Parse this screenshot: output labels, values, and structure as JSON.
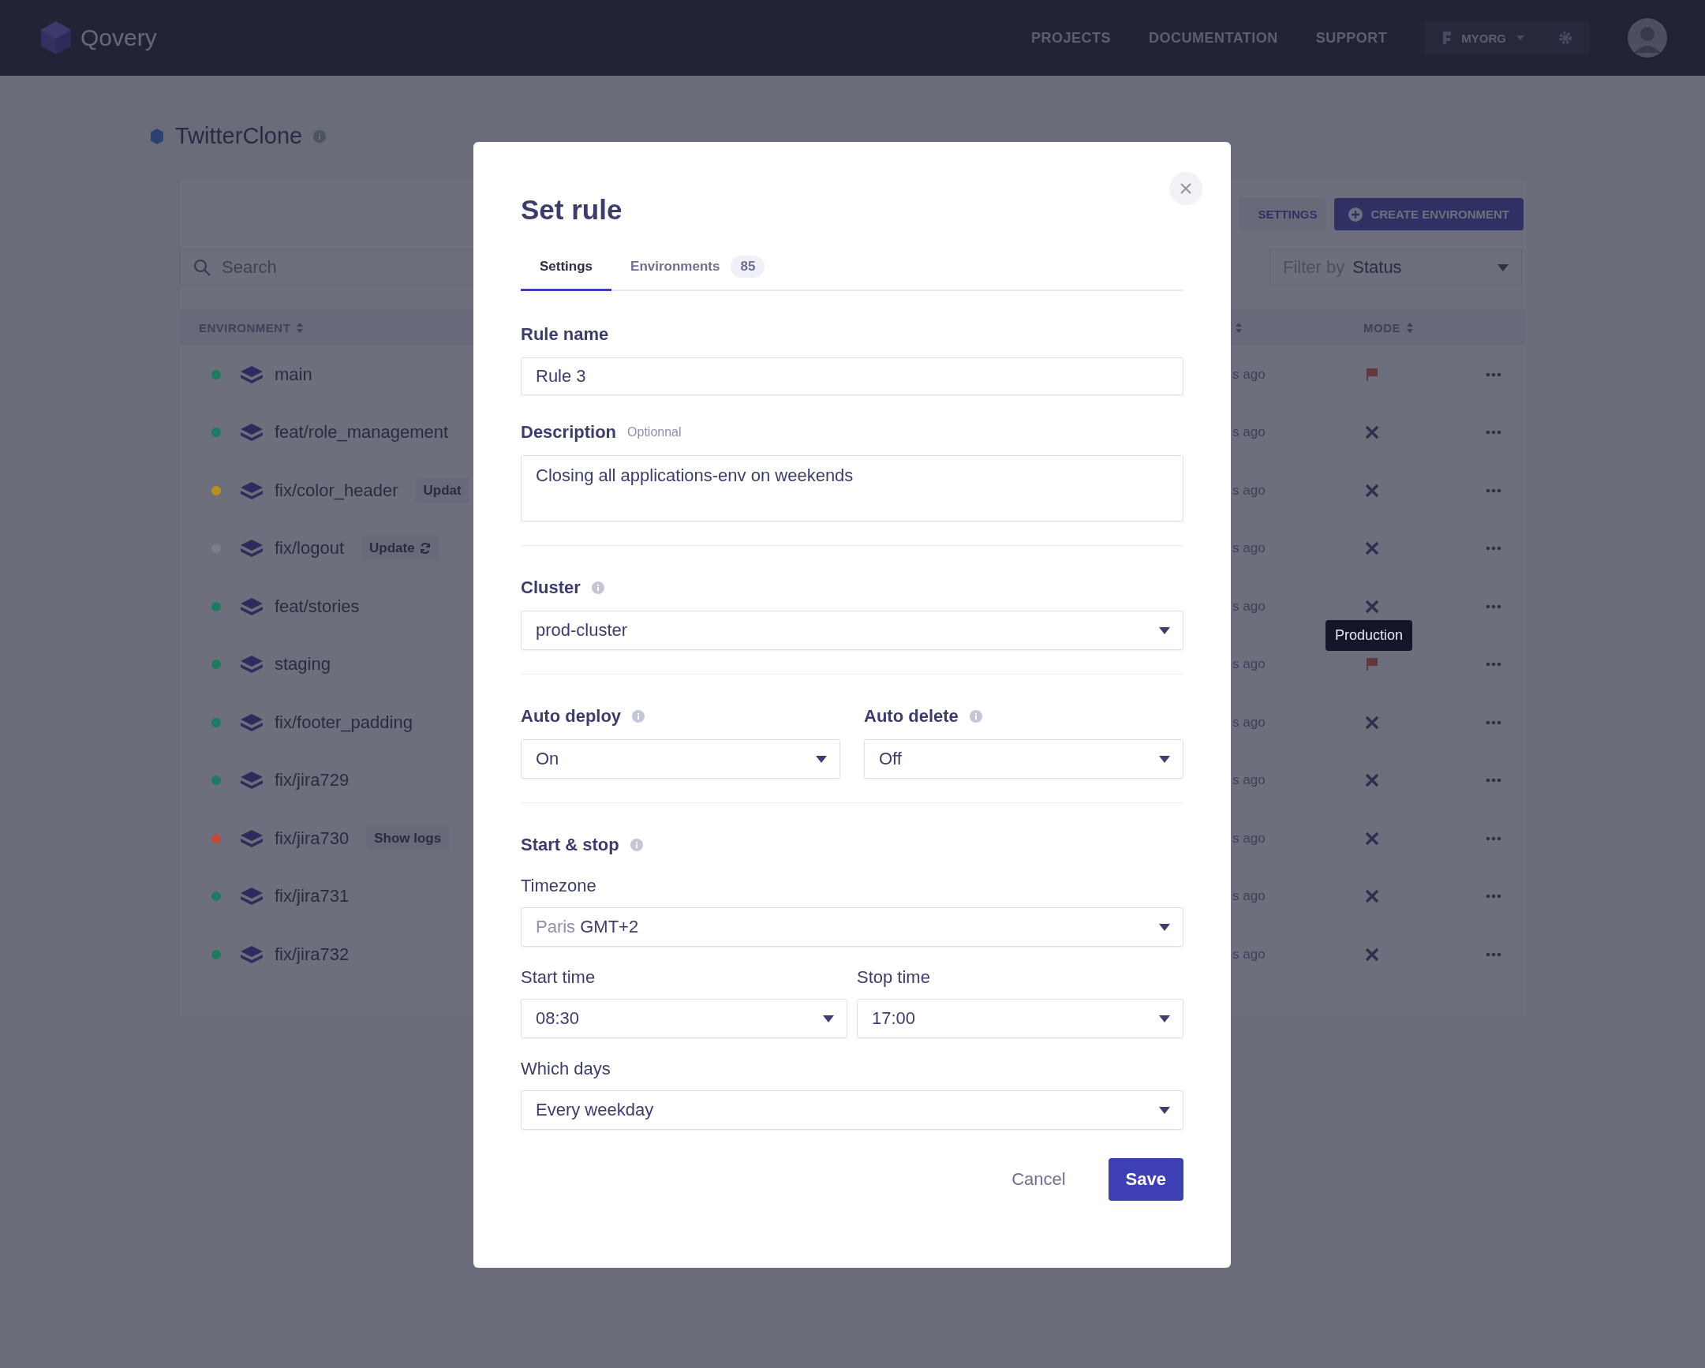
{
  "topbar": {
    "brand": "Qovery",
    "nav": [
      {
        "label": "PROJECTS"
      },
      {
        "label": "DOCUMENTATION"
      },
      {
        "label": "SUPPORT"
      }
    ],
    "org": "MYORG"
  },
  "project": {
    "title": "TwitterClone"
  },
  "toolbar": {
    "settings": "SETTINGS",
    "create": "CREATE ENVIRONMENT",
    "search_placeholder": "Search",
    "filter_label": "Filter by",
    "filter_value": "Status"
  },
  "table": {
    "columns": [
      "ENVIRONMENT",
      "MODE"
    ],
    "rows": [
      {
        "name": "main",
        "color": "#1e7a60",
        "updated": "s ago",
        "kind": "production"
      },
      {
        "name": "feat/role_management",
        "color": "#1e7a60",
        "updated": "s ago",
        "kind": "development"
      },
      {
        "name": "fix/color_header",
        "color": "#b8901e",
        "badge": {
          "label": "Updat",
          "kind": "plain"
        },
        "updated": "s ago",
        "kind": "development"
      },
      {
        "name": "fix/logout",
        "color": "#7c7e8c",
        "badge": {
          "label": "Update",
          "kind": "refresh"
        },
        "updated": "s ago",
        "kind": "development"
      },
      {
        "name": "feat/stories",
        "color": "#1e7a60",
        "updated": "s ago",
        "kind": "development"
      },
      {
        "name": "staging",
        "color": "#1e7a60",
        "updated": "s ago",
        "kind": "production"
      },
      {
        "name": "fix/footer_padding",
        "color": "#1e7a60",
        "updated": "s ago",
        "kind": "development"
      },
      {
        "name": "fix/jira729",
        "color": "#1e7a60",
        "updated": "s ago",
        "kind": "development"
      },
      {
        "name": "fix/jira730",
        "color": "#c24a36",
        "badge": {
          "label": "Show logs",
          "kind": "plain"
        },
        "updated": "s ago",
        "kind": "development"
      },
      {
        "name": "fix/jira731",
        "color": "#1e7a60",
        "updated": "s ago",
        "kind": "development"
      },
      {
        "name": "fix/jira732",
        "color": "#1e7a60",
        "updated": "s ago",
        "kind": "development"
      }
    ]
  },
  "tooltip": "Production",
  "modal": {
    "title": "Set rule",
    "tabs": [
      {
        "label": "Settings",
        "selected": true
      },
      {
        "label": "Environments",
        "count": "85",
        "selected": false
      }
    ],
    "rule_name": {
      "label": "Rule name",
      "value": "Rule 3"
    },
    "description": {
      "label": "Description",
      "hint": "Optionnal",
      "value": "Closing all applications-env on weekends"
    },
    "cluster": {
      "label": "Cluster",
      "value": "prod-cluster"
    },
    "auto_deploy": {
      "label": "Auto deploy",
      "value": "On"
    },
    "auto_delete": {
      "label": "Auto delete",
      "value": "Off"
    },
    "start_stop": {
      "label": "Start & stop"
    },
    "timezone": {
      "label": "Timezone",
      "city": "Paris",
      "value": "GMT+2"
    },
    "start_time": {
      "label": "Start time",
      "value": "08:30"
    },
    "stop_time": {
      "label": "Stop time",
      "value": "17:00"
    },
    "days": {
      "label": "Which days",
      "value": "Every weekday"
    },
    "buttons": {
      "cancel": "Cancel",
      "save": "Save"
    }
  }
}
